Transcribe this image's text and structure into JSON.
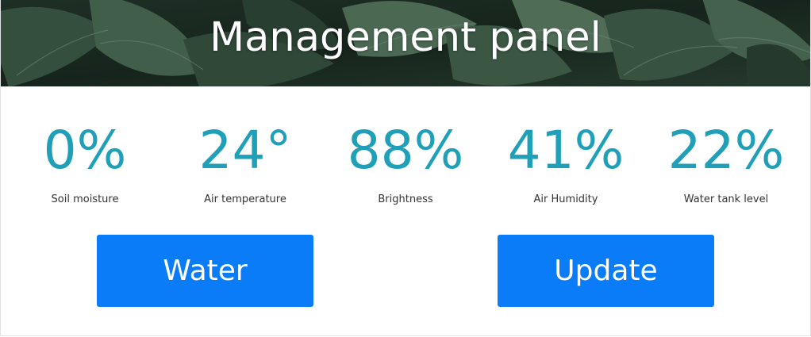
{
  "header": {
    "title": "Management panel"
  },
  "stats": [
    {
      "value": "0%",
      "label": "Soil moisture"
    },
    {
      "value": "24°",
      "label": "Air temperature"
    },
    {
      "value": "88%",
      "label": "Brightness"
    },
    {
      "value": "41%",
      "label": "Air Humidity"
    },
    {
      "value": "22%",
      "label": "Water tank level"
    }
  ],
  "actions": {
    "water_label": "Water",
    "update_label": "Update"
  },
  "colors": {
    "accent": "#1fa0b8",
    "button": "#0a7cf8",
    "label": "#333333"
  }
}
